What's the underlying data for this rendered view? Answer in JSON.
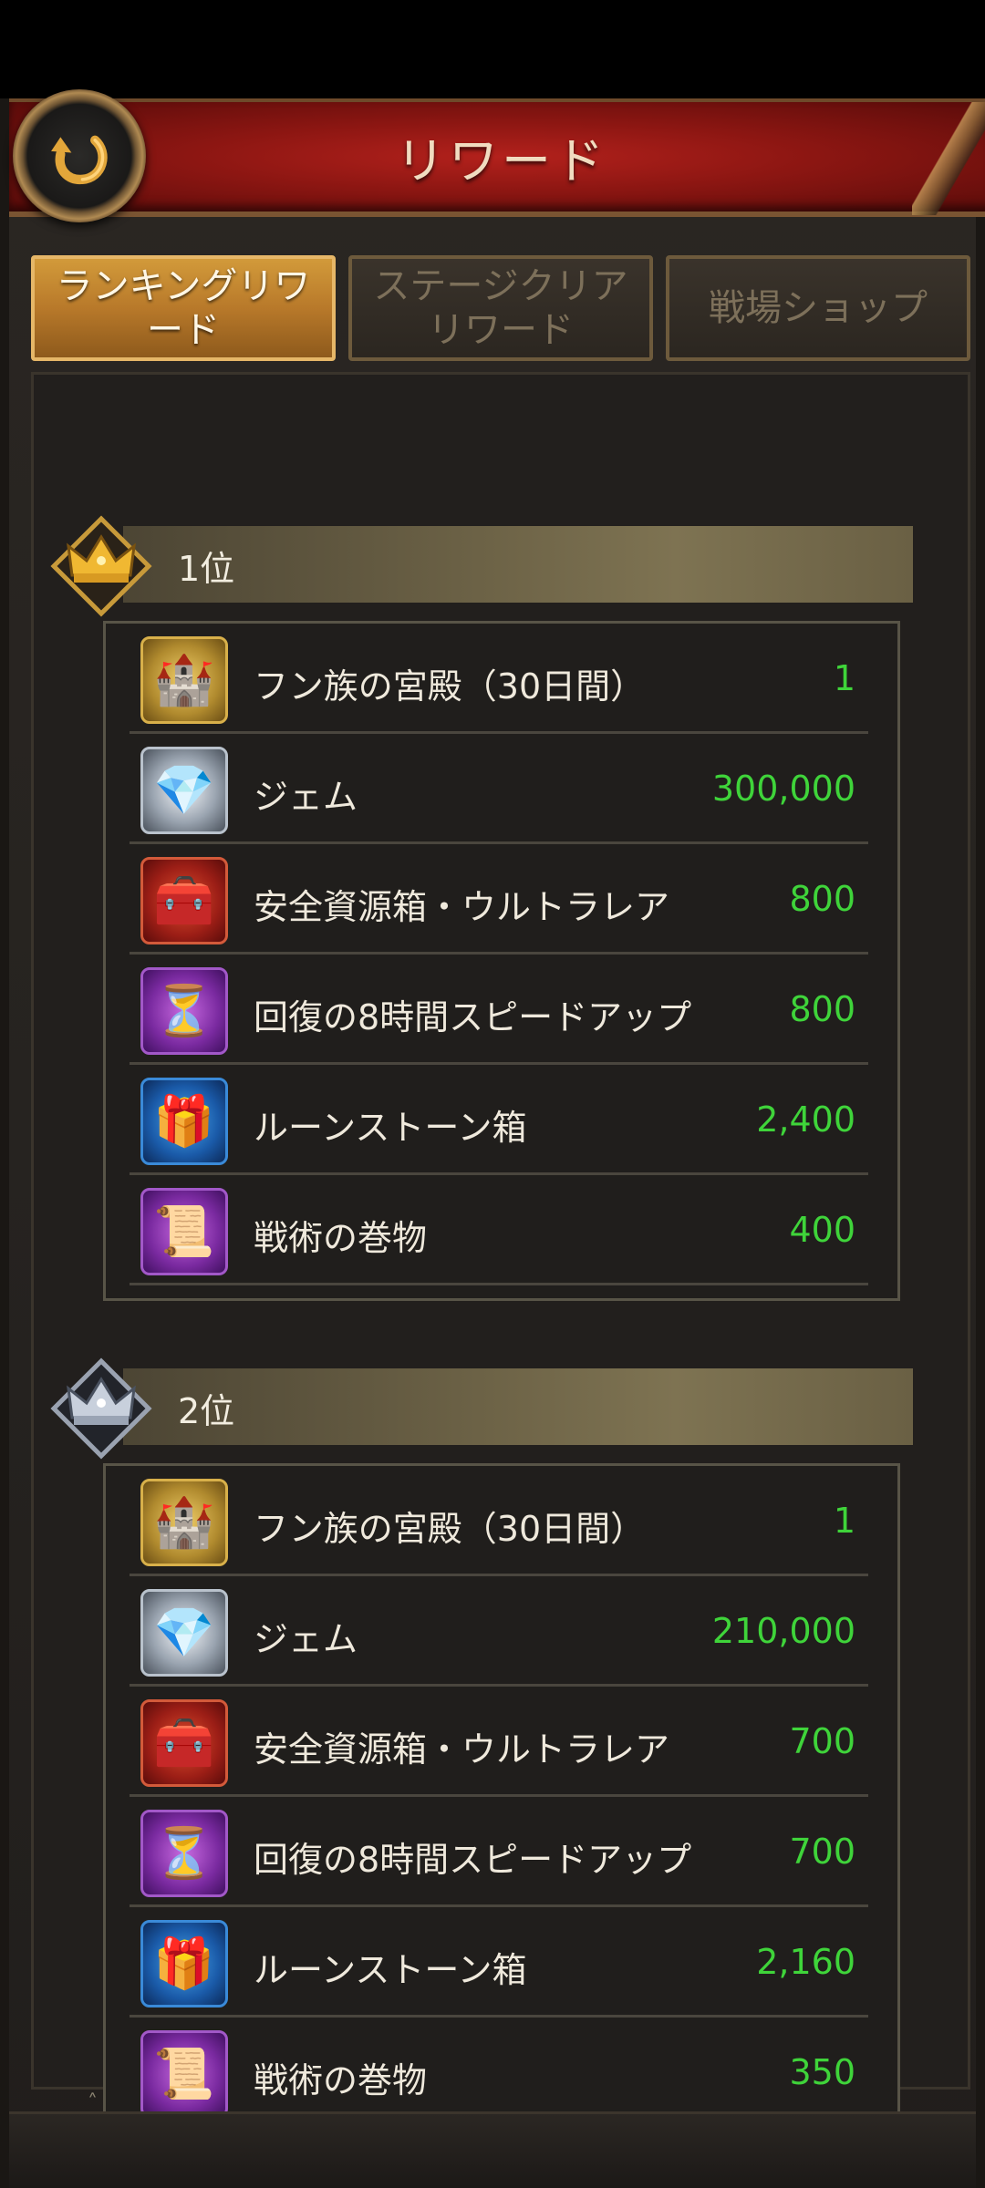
{
  "header": {
    "title": "リワード",
    "back_icon": "back-arrow-icon"
  },
  "tabs": [
    {
      "label": "ランキングリワード",
      "active": true
    },
    {
      "label": "ステージクリアリワード",
      "active": false
    },
    {
      "label": "戦場ショップ",
      "active": false
    }
  ],
  "ranks": [
    {
      "label": "1位",
      "emblem": "gold-crown-icon",
      "items": [
        {
          "icon": "palace-icon",
          "name": "フン族の宮殿（30日間）",
          "count": "1"
        },
        {
          "icon": "gem-icon",
          "name": "ジェム",
          "count": "300,000"
        },
        {
          "icon": "resource-chest-icon",
          "name": "安全資源箱・ウルトラレア",
          "count": "800"
        },
        {
          "icon": "hourglass-speedup-icon",
          "name": "回復の8時間スピードアップ",
          "count": "800"
        },
        {
          "icon": "runestone-chest-icon",
          "name": "ルーンストーン箱",
          "count": "2,400"
        },
        {
          "icon": "scroll-icon",
          "name": "戦術の巻物",
          "count": "400"
        }
      ]
    },
    {
      "label": "2位",
      "emblem": "silver-crown-icon",
      "items": [
        {
          "icon": "palace-icon",
          "name": "フン族の宮殿（30日間）",
          "count": "1"
        },
        {
          "icon": "gem-icon",
          "name": "ジェム",
          "count": "210,000"
        },
        {
          "icon": "resource-chest-icon",
          "name": "安全資源箱・ウルトラレア",
          "count": "700"
        },
        {
          "icon": "hourglass-speedup-icon",
          "name": "回復の8時間スピードアップ",
          "count": "700"
        },
        {
          "icon": "runestone-chest-icon",
          "name": "ルーンストーン箱",
          "count": "2,160"
        },
        {
          "icon": "scroll-icon",
          "name": "戦術の巻物",
          "count": "350"
        }
      ]
    }
  ],
  "colors": {
    "count_green": "#3fd43a",
    "header_red": "#8c1612",
    "tab_active": "#b8792a"
  }
}
